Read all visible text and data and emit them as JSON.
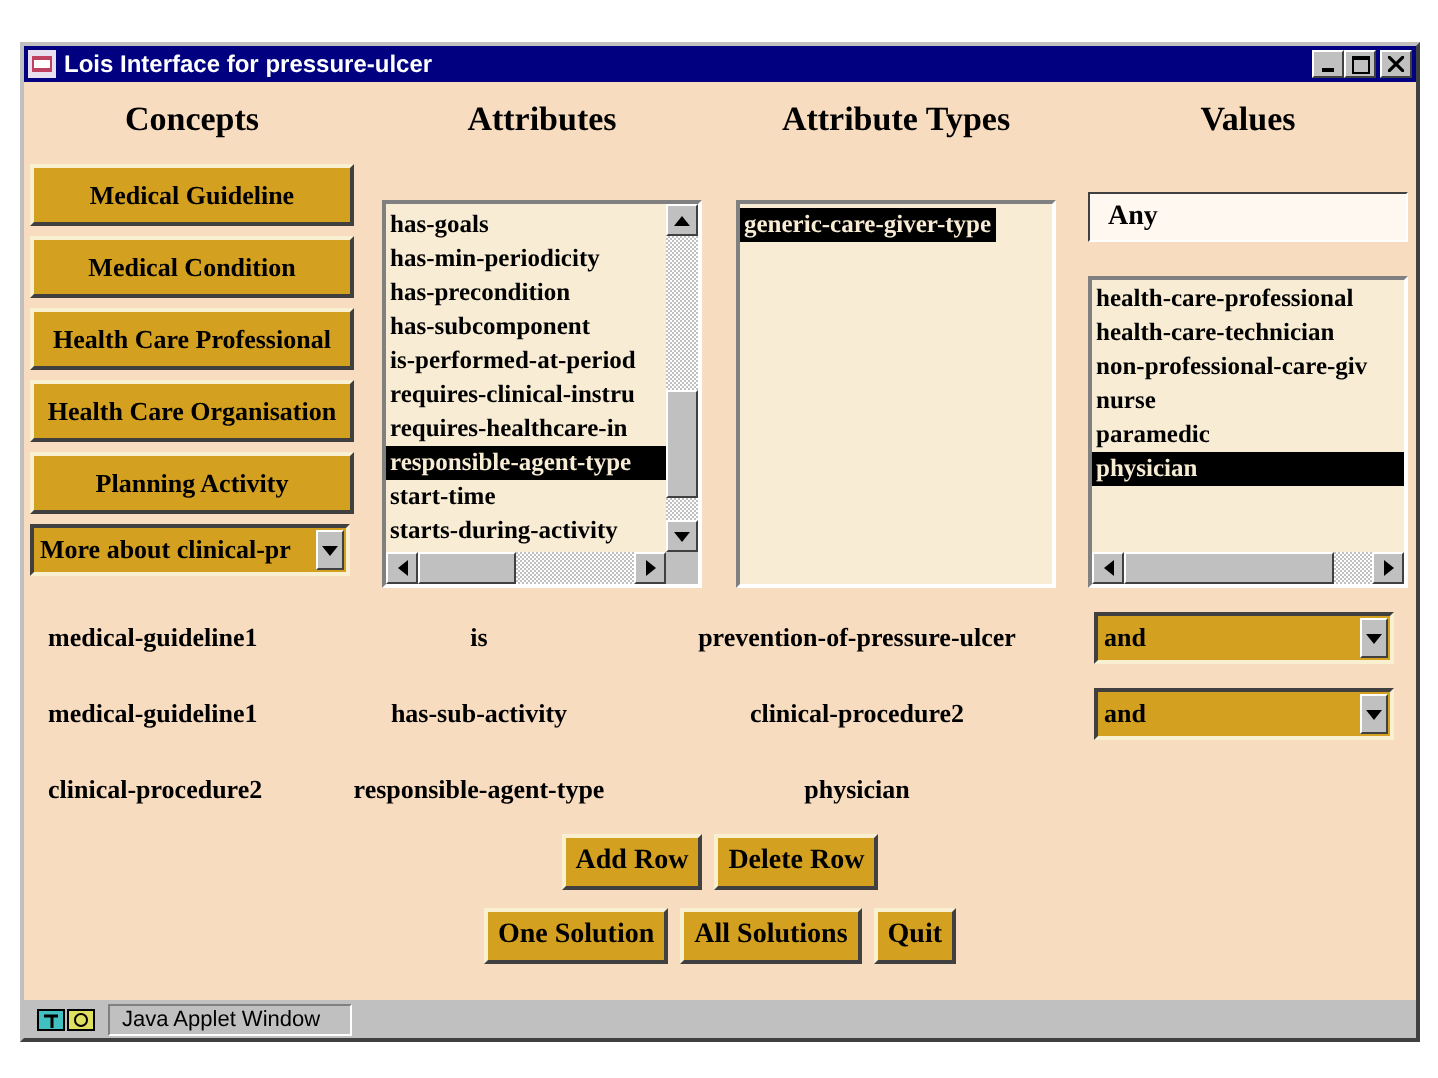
{
  "window": {
    "title": "Lois Interface for pressure-ulcer"
  },
  "headings": [
    "Concepts",
    "Attributes",
    "Attribute Types",
    "Values"
  ],
  "concepts": {
    "buttons": [
      "Medical Guideline",
      "Medical Condition",
      "Health Care Professional",
      "Health Care Organisation",
      "Planning Activity"
    ],
    "dropdown": {
      "value": "More about clinical-pr"
    }
  },
  "attributes": {
    "items": [
      {
        "label": "has-goals",
        "selected": false
      },
      {
        "label": "has-min-periodicity",
        "selected": false
      },
      {
        "label": "has-precondition",
        "selected": false
      },
      {
        "label": "has-subcomponent",
        "selected": false
      },
      {
        "label": "is-performed-at-period",
        "selected": false
      },
      {
        "label": "requires-clinical-instru",
        "selected": false
      },
      {
        "label": "requires-healthcare-in",
        "selected": false
      },
      {
        "label": "responsible-agent-type",
        "selected": true
      },
      {
        "label": "start-time",
        "selected": false
      },
      {
        "label": "starts-during-activity",
        "selected": false
      }
    ]
  },
  "attribute_types": {
    "items": [
      {
        "label": "generic-care-giver-type",
        "selected": true
      }
    ]
  },
  "values": {
    "field_value": "Any",
    "items": [
      {
        "label": "health-care-professional",
        "selected": false
      },
      {
        "label": "health-care-technician",
        "selected": false
      },
      {
        "label": "non-professional-care-giv",
        "selected": false
      },
      {
        "label": "nurse",
        "selected": false
      },
      {
        "label": "paramedic",
        "selected": false
      },
      {
        "label": "physician",
        "selected": true
      }
    ]
  },
  "query_rows": [
    {
      "subject": "medical-guideline1",
      "attribute": "is",
      "value": "prevention-of-pressure-ulcer",
      "connector": "and"
    },
    {
      "subject": "medical-guideline1",
      "attribute": "has-sub-activity",
      "value": "clinical-procedure2",
      "connector": "and"
    },
    {
      "subject": "clinical-procedure2",
      "attribute": "responsible-agent-type",
      "value": "physician"
    }
  ],
  "row_buttons": [
    "Add Row",
    "Delete Row"
  ],
  "action_buttons": [
    "One Solution",
    "All Solutions",
    "Quit"
  ],
  "status_bar": {
    "label": "Java Applet Window"
  }
}
